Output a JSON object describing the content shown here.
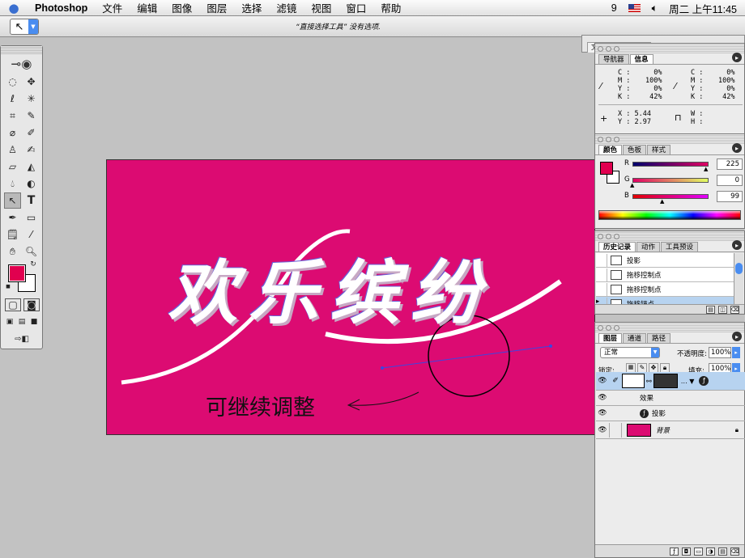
{
  "menubar": {
    "items": [
      "Photoshop",
      "文件",
      "编辑",
      "图像",
      "图层",
      "选择",
      "滤镜",
      "视图",
      "窗口",
      "帮助"
    ],
    "clock": "周二 上午11:45",
    "status_num": "9"
  },
  "options": {
    "message": "“直接选择工具” 没有选项.",
    "well_tabs": [
      "文件浏览器",
      "画笔"
    ]
  },
  "canvas": {
    "art_text": "欢乐缤纷",
    "note": "可继续调整",
    "bg_color": "#dc0b72"
  },
  "info_panel": {
    "tabs": [
      "导航器",
      "信息"
    ],
    "active_tab": "信息",
    "cmyk_left": {
      "C": "0%",
      "M": "100%",
      "Y": "0%",
      "K": "42%"
    },
    "cmyk_right": {
      "C": "0%",
      "M": "100%",
      "Y": "0%",
      "K": "42%"
    },
    "x_label": "X :",
    "x_value": "5.44",
    "y_label": "Y :",
    "y_value": "2.97",
    "w_label": "W :",
    "h_label": "H :"
  },
  "color_panel": {
    "tabs": [
      "颜色",
      "色板",
      "样式"
    ],
    "active_tab": "颜色",
    "r_label": "R",
    "r_value": "225",
    "g_label": "G",
    "g_value": "0",
    "b_label": "B",
    "b_value": "99",
    "fg_color": "#e1004f"
  },
  "history_panel": {
    "tabs": [
      "历史记录",
      "动作",
      "工具预设"
    ],
    "active_tab": "历史记录",
    "items": [
      "投影",
      "拖移控制点",
      "拖移控制点",
      "拖移锚点"
    ],
    "selected_index": 3
  },
  "layers_panel": {
    "tabs": [
      "图层",
      "通道",
      "路径"
    ],
    "active_tab": "图层",
    "blend_mode": "正常",
    "opacity_label": "不透明度:",
    "opacity_value": "100%",
    "lock_label": "锁定:",
    "fill_label": "填充:",
    "fill_value": "100%",
    "effects_label": "效果",
    "effect_item": "投影",
    "background_label": "背景"
  }
}
